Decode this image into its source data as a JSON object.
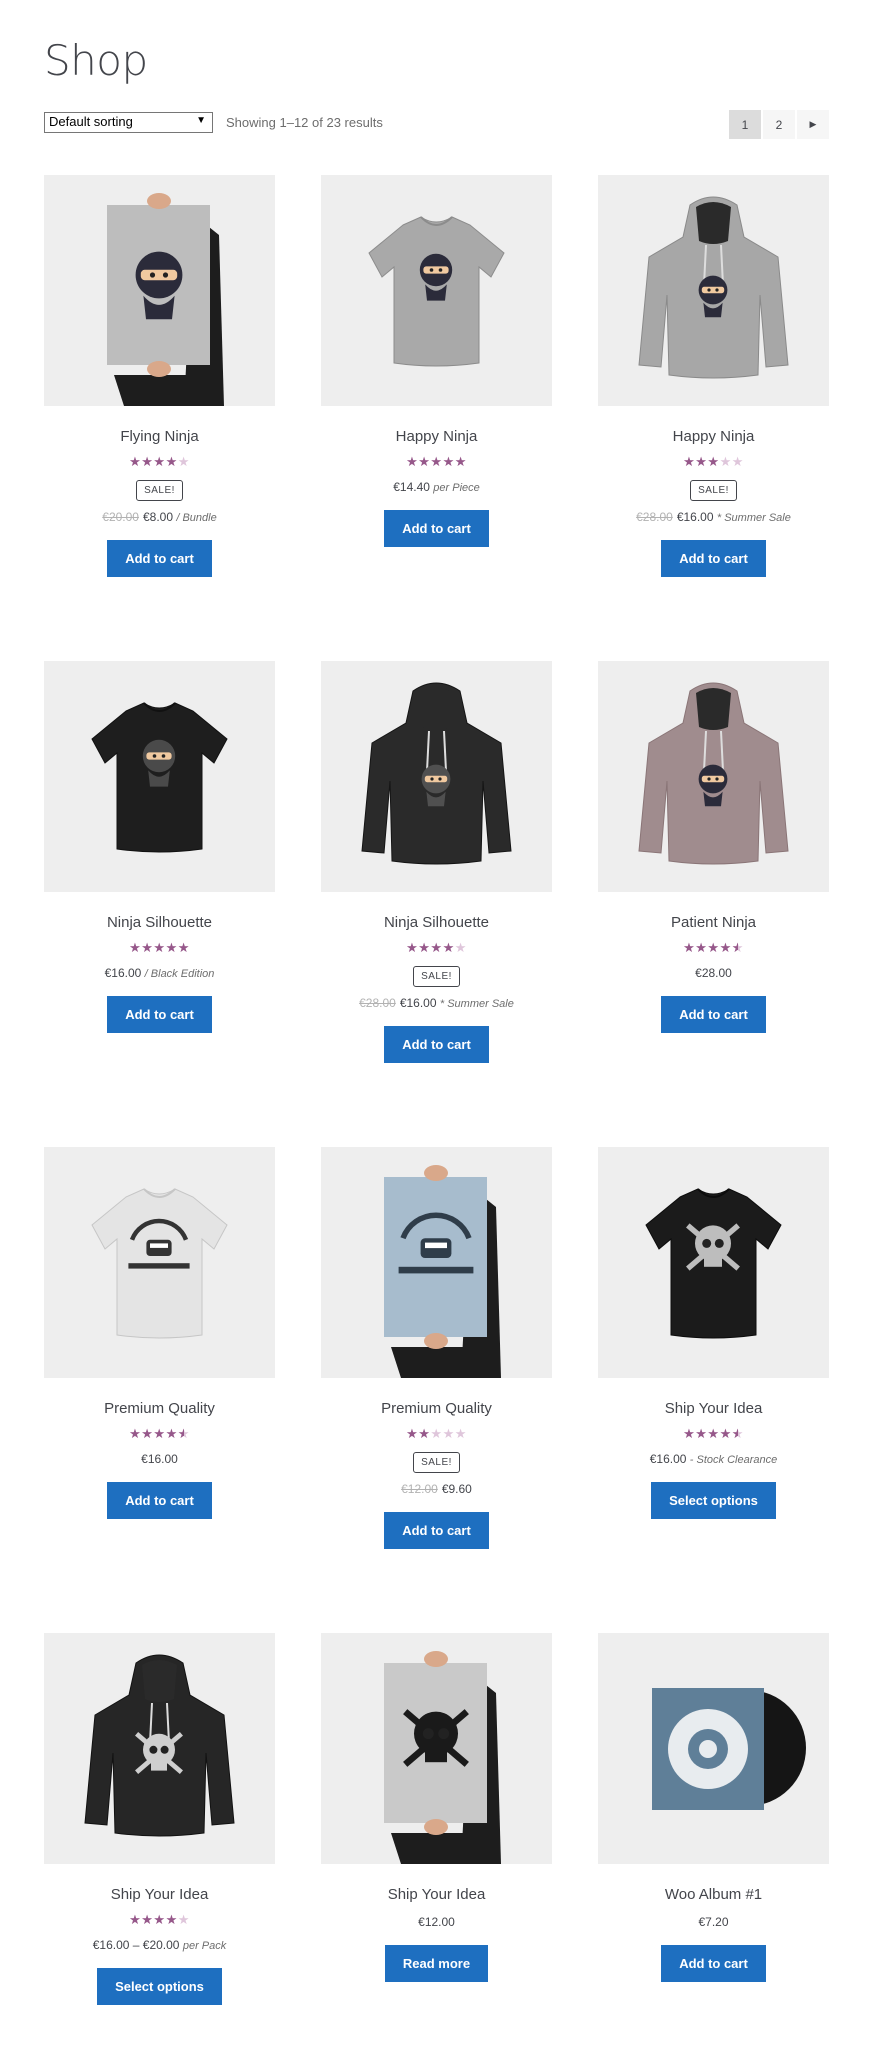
{
  "page": {
    "title": "Shop"
  },
  "toolbar": {
    "sort_selected": "Default sorting",
    "result_count": "Showing 1–12 of 23 results",
    "pages": [
      "1",
      "2"
    ],
    "current_page": "1",
    "next_icon": "triangle-right"
  },
  "colors": {
    "accent": "#1e6fc0",
    "star": "#96588a",
    "star_empty": "#dfc6db",
    "thumb_bg": "#eeeeee"
  },
  "products": [
    {
      "title": "Flying Ninja",
      "rating": 4,
      "sale": "SALE!",
      "old_price": "€20.00",
      "price": "€8.00",
      "suffix": "/ Bundle",
      "button": "Add to cart",
      "image": "poster-ninja"
    },
    {
      "title": "Happy Ninja",
      "rating": 5,
      "sale": "",
      "old_price": "",
      "price": "€14.40",
      "suffix": "per Piece",
      "button": "Add to cart",
      "image": "tshirt-grey-ninja"
    },
    {
      "title": "Happy Ninja",
      "rating": 3,
      "sale": "SALE!",
      "old_price": "€28.00",
      "price": "€16.00",
      "suffix": "* Summer Sale",
      "button": "Add to cart",
      "image": "hoodie-grey-ninja"
    },
    {
      "title": "Ninja Silhouette",
      "rating": 5,
      "sale": "",
      "old_price": "",
      "price": "€16.00",
      "suffix": "/ Black Edition",
      "button": "Add to cart",
      "image": "tshirt-black-ninja"
    },
    {
      "title": "Ninja Silhouette",
      "rating": 4,
      "sale": "SALE!",
      "old_price": "€28.00",
      "price": "€16.00",
      "suffix": "* Summer Sale",
      "button": "Add to cart",
      "image": "hoodie-black-ninja"
    },
    {
      "title": "Patient Ninja",
      "rating": 4.5,
      "sale": "",
      "old_price": "",
      "price": "€28.00",
      "suffix": "",
      "button": "Add to cart",
      "image": "hoodie-mauve-ninja"
    },
    {
      "title": "Premium Quality",
      "rating": 4.5,
      "sale": "",
      "old_price": "",
      "price": "€16.00",
      "suffix": "",
      "button": "Add to cart",
      "image": "tshirt-white-woo"
    },
    {
      "title": "Premium Quality",
      "rating": 2,
      "sale": "SALE!",
      "old_price": "€12.00",
      "price": "€9.60",
      "suffix": "",
      "button": "Add to cart",
      "image": "poster-woo"
    },
    {
      "title": "Ship Your Idea",
      "rating": 4.5,
      "sale": "",
      "old_price": "",
      "price": "€16.00",
      "suffix": "- Stock Clearance",
      "button": "Select options",
      "image": "tshirt-black-skull"
    },
    {
      "title": "Ship Your Idea",
      "rating": 4,
      "sale": "",
      "old_price": "",
      "price": "€16.00 – €20.00",
      "suffix": "per Pack",
      "button": "Select options",
      "image": "hoodie-black-skull"
    },
    {
      "title": "Ship Your Idea",
      "rating": 0,
      "sale": "",
      "old_price": "",
      "price": "€12.00",
      "suffix": "",
      "button": "Read more",
      "image": "poster-skull"
    },
    {
      "title": "Woo Album #1",
      "rating": 0,
      "sale": "",
      "old_price": "",
      "price": "€7.20",
      "suffix": "",
      "button": "Add to cart",
      "image": "vinyl-album"
    }
  ]
}
